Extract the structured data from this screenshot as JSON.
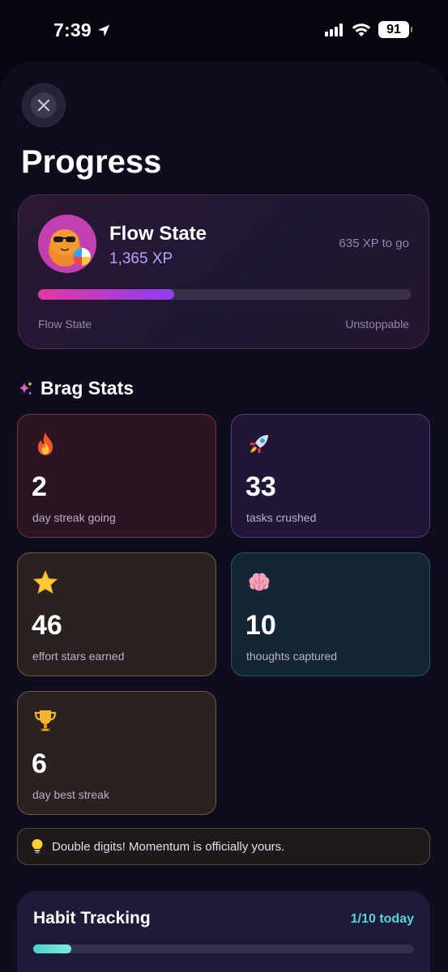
{
  "status_bar": {
    "time": "7:39",
    "battery": "91"
  },
  "page": {
    "title": "Progress"
  },
  "level": {
    "name": "Flow State",
    "xp": "1,365 XP",
    "to_go": "635 XP to go",
    "progress": 0.365,
    "from_label": "Flow State",
    "to_label": "Unstoppable"
  },
  "brag": {
    "heading": "Brag Stats",
    "stats": [
      {
        "icon": "fire-icon",
        "value": "2",
        "label": "day streak going",
        "theme": "red"
      },
      {
        "icon": "rocket-icon",
        "value": "33",
        "label": "tasks crushed",
        "theme": "purple"
      },
      {
        "icon": "star-icon",
        "value": "46",
        "label": "effort stars earned",
        "theme": "brown"
      },
      {
        "icon": "brain-icon",
        "value": "10",
        "label": "thoughts captured",
        "theme": "teal"
      },
      {
        "icon": "trophy-icon",
        "value": "6",
        "label": "day best streak",
        "theme": "brown"
      }
    ]
  },
  "tip": {
    "icon": "lightbulb-icon",
    "text": "Double digits! Momentum is officially yours."
  },
  "habit": {
    "title": "Habit Tracking",
    "count": "1/10 today",
    "progress": 0.1
  },
  "colors": {
    "background": "#0e0d1d",
    "accent_pink": "#e2399f",
    "accent_purple": "#8e3ef3",
    "accent_teal": "#58d6d0"
  }
}
